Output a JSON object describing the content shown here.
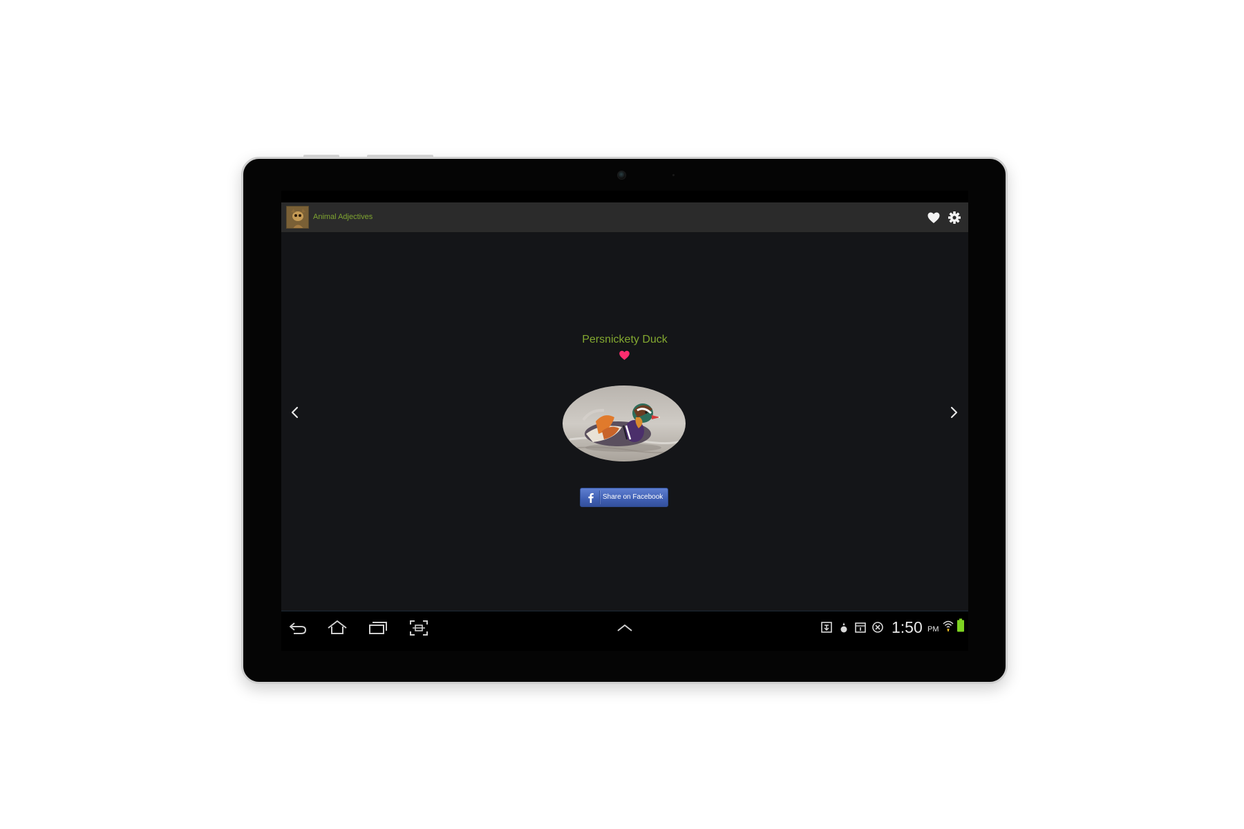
{
  "app": {
    "title": "Animal Adjectives"
  },
  "action_bar": {
    "icons": [
      "favorites-heart-icon",
      "settings-gear-icon"
    ]
  },
  "content": {
    "title": "Persnickety Duck",
    "favorited": true,
    "photo_subject": "mandarin duck",
    "share_button_label": "Share on Facebook",
    "heart_color": "#ff2d6f"
  },
  "system_bar": {
    "clock": "1:50",
    "ampm": "PM",
    "battery_color": "#7dd321",
    "nav_icons": [
      "back-icon",
      "home-icon",
      "recent-apps-icon",
      "screenshot-icon",
      "expand-up-icon"
    ]
  },
  "colors": {
    "accent_green": "#83a830",
    "facebook_blue": "#3f5fb3"
  }
}
